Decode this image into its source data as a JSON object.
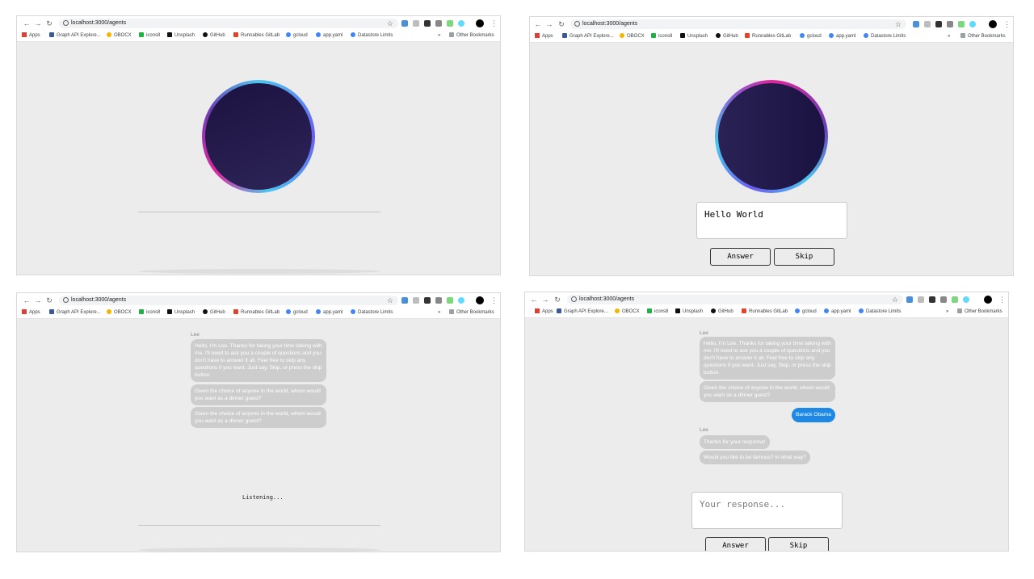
{
  "browser": {
    "url": "localhost:3000/agents",
    "bookmarks": [
      "Apps",
      "Graph API Explore...",
      "OBOCX",
      "icons8",
      "Unsplash",
      "GitHub",
      "Runnables GitLab",
      "gcloud",
      "app.yaml",
      "Datastore Limits"
    ],
    "more": "»",
    "other_bookmarks": "Other Bookmarks"
  },
  "colors": {
    "orb_dark": "#1c1440",
    "orb_ring_pink": "#e0259e",
    "orb_ring_blue": "#4cc7f0",
    "orb_ring_purple": "#6a5df0",
    "user_bubble": "#1e88e5"
  },
  "panels": {
    "p2": {
      "input_value": "Hello World",
      "answer": "Answer",
      "skip": "Skip"
    },
    "p3": {
      "sender": "Lee",
      "messages": [
        "Hello, I'm Lee. Thanks for taking your time talking with me. I'll need to ask you a couple of questions and you don't have to answer it all. Feel free to skip any questions if you want. Just say, Skip, or press the skip button.",
        "Given the choice of anyone in the world, whom would you want as a dinner guest?",
        "Given the choice of anyone in the world, whom would you want as a dinner guest?"
      ],
      "status": "Listening..."
    },
    "p4": {
      "sender1": "Lee",
      "messages1": [
        "Hello, I'm Lee. Thanks for taking your time talking with me. I'll need to ask you a couple of questions and you don't have to answer it all. Feel free to skip any questions if you want. Just say, Skip, or press the skip button.",
        "Given the choice of anyone in the world, whom would you want as a dinner guest?"
      ],
      "user_reply": "Barack Obama",
      "sender2": "Lee",
      "messages2": [
        "Thanks for your response!",
        "Would you like to be famous? In what way?"
      ],
      "input_placeholder": "Your response...",
      "answer": "Answer",
      "skip": "Skip"
    }
  }
}
